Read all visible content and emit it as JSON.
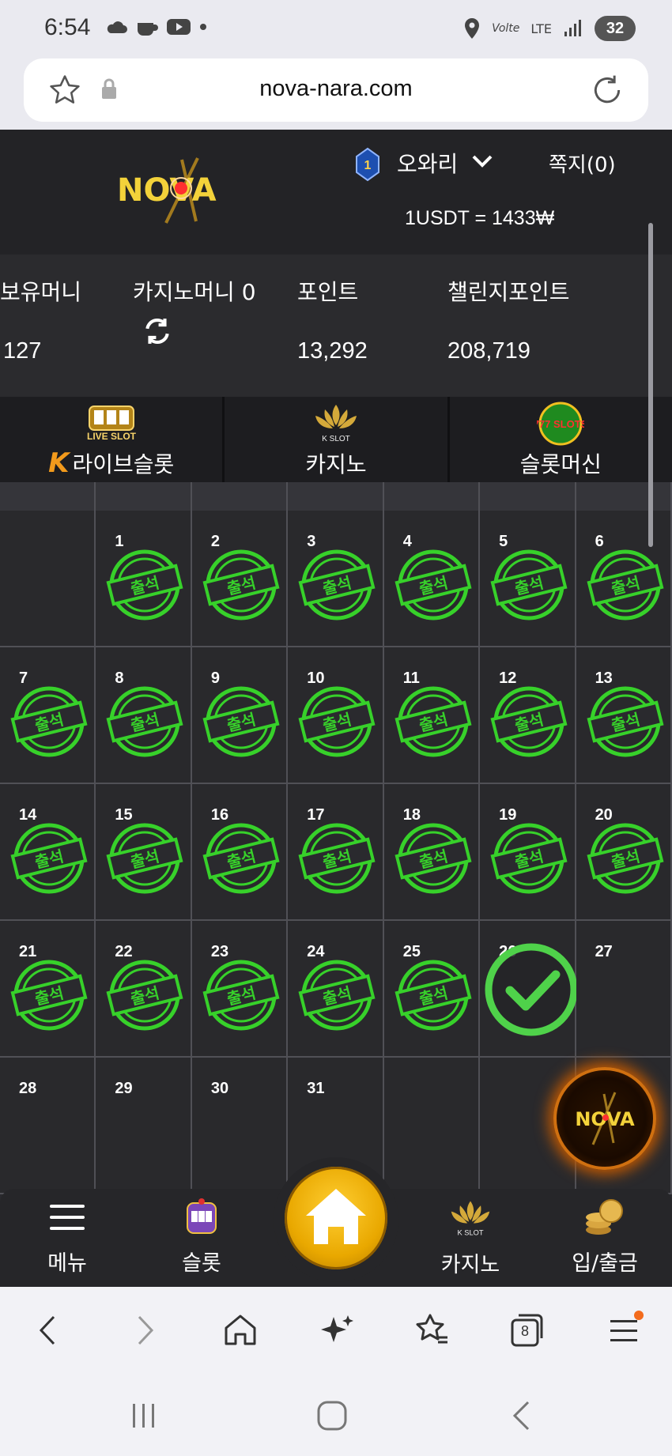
{
  "status_bar": {
    "time": "6:54",
    "network": "LTE",
    "volte": "Volte",
    "battery": "32"
  },
  "browser": {
    "url": "nova-nara.com",
    "tab_count": "8"
  },
  "header": {
    "logo_text": "NOVA",
    "level": "1",
    "username": "오와리",
    "messages": "쪽지(0)",
    "exchange_rate": "1USDT = 1433₩"
  },
  "balances": {
    "money_label": "보유머니",
    "money_value": "127",
    "casino_label": "카지노머니 0",
    "points_label": "포인트",
    "points_value": "13,292",
    "challenge_label": "챌린지포인트",
    "challenge_value": "208,719"
  },
  "game_tabs": [
    {
      "label": "라이브슬롯",
      "icon_text": "LIVE SLOT"
    },
    {
      "label": "카지노",
      "icon_text": "K SLOT"
    },
    {
      "label": "슬롯머신",
      "icon_text": "777 SLOTS"
    }
  ],
  "calendar": {
    "stamp_text": "출석",
    "days": [
      {
        "n": "",
        "s": "empty"
      },
      {
        "n": "1",
        "s": "stamp"
      },
      {
        "n": "2",
        "s": "stamp"
      },
      {
        "n": "3",
        "s": "stamp"
      },
      {
        "n": "4",
        "s": "stamp"
      },
      {
        "n": "5",
        "s": "stamp"
      },
      {
        "n": "6",
        "s": "stamp"
      },
      {
        "n": "7",
        "s": "stamp"
      },
      {
        "n": "8",
        "s": "stamp"
      },
      {
        "n": "9",
        "s": "stamp"
      },
      {
        "n": "10",
        "s": "stamp"
      },
      {
        "n": "11",
        "s": "stamp"
      },
      {
        "n": "12",
        "s": "stamp"
      },
      {
        "n": "13",
        "s": "stamp"
      },
      {
        "n": "14",
        "s": "stamp"
      },
      {
        "n": "15",
        "s": "stamp"
      },
      {
        "n": "16",
        "s": "stamp"
      },
      {
        "n": "17",
        "s": "stamp"
      },
      {
        "n": "18",
        "s": "stamp"
      },
      {
        "n": "19",
        "s": "stamp"
      },
      {
        "n": "20",
        "s": "stamp"
      },
      {
        "n": "21",
        "s": "stamp"
      },
      {
        "n": "22",
        "s": "stamp"
      },
      {
        "n": "23",
        "s": "stamp"
      },
      {
        "n": "24",
        "s": "stamp"
      },
      {
        "n": "25",
        "s": "stamp"
      },
      {
        "n": "26",
        "s": "check"
      },
      {
        "n": "27",
        "s": "none"
      },
      {
        "n": "28",
        "s": "none"
      },
      {
        "n": "29",
        "s": "none"
      },
      {
        "n": "30",
        "s": "none"
      },
      {
        "n": "31",
        "s": "none"
      },
      {
        "n": "",
        "s": "empty"
      },
      {
        "n": "",
        "s": "empty"
      },
      {
        "n": "",
        "s": "empty"
      }
    ]
  },
  "bottom_nav": {
    "menu": "메뉴",
    "slot": "슬롯",
    "casino": "카지노",
    "deposit": "입/출금",
    "casino_icon_text": "K SLOT"
  },
  "colors": {
    "stamp_green": "#37d12a",
    "home_gold": "#f2b705",
    "bg_dark": "#252528"
  }
}
